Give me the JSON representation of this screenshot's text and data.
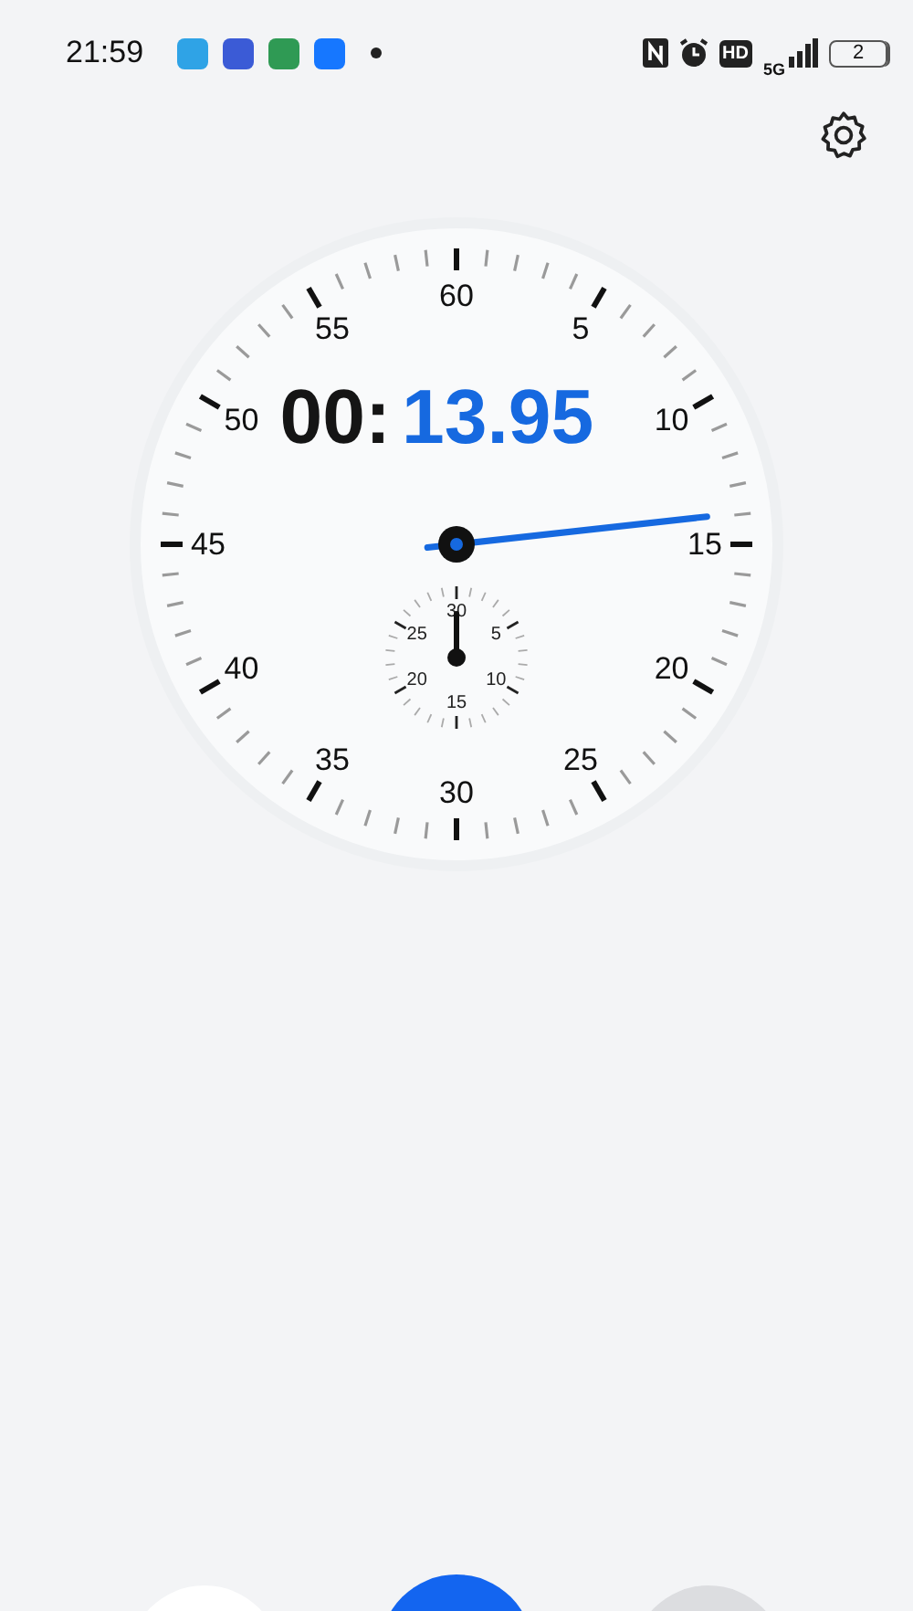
{
  "status_bar": {
    "time": "21:59",
    "notification_icons": [
      {
        "color": "#2fa3e6"
      },
      {
        "color": "#3b5bd6"
      },
      {
        "color": "#2f9a54"
      },
      {
        "color": "#1677ff"
      }
    ],
    "hd_label": "HD",
    "network_label": "5G",
    "battery_label": "2"
  },
  "stopwatch": {
    "minutes_text": "00:",
    "seconds_text": "13.95",
    "dial_labels": [
      "60",
      "5",
      "10",
      "15",
      "20",
      "25",
      "30",
      "35",
      "40",
      "45",
      "50",
      "55"
    ],
    "minute_subdial": {
      "labels": [
        "30",
        "5",
        "10",
        "15",
        "20",
        "25"
      ]
    }
  },
  "bottom_buttons": [
    {
      "kind": "secondary"
    },
    {
      "kind": "primary"
    },
    {
      "kind": "neutral"
    }
  ]
}
